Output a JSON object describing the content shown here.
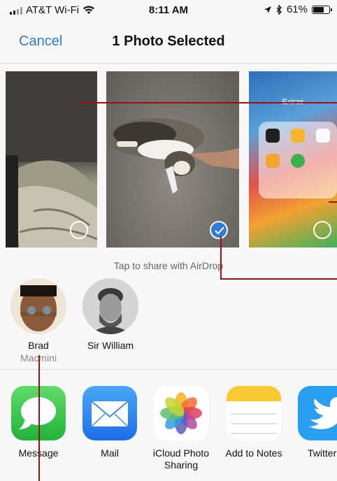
{
  "status_bar": {
    "carrier": "AT&T Wi-Fi",
    "time": "8:11 AM",
    "battery": "61%",
    "battery_level": 0.61
  },
  "nav": {
    "cancel_label": "Cancel",
    "title": "1 Photo Selected"
  },
  "photos": [
    {
      "name": "photo-1",
      "selected": false
    },
    {
      "name": "photo-2",
      "selected": true
    },
    {
      "name": "photo-3",
      "selected": false
    }
  ],
  "photo3_overlay": {
    "folder_label": "Extras"
  },
  "airdrop": {
    "hint": "Tap to share with AirDrop",
    "contacts": [
      {
        "name": "Brad",
        "device": "Macmini"
      },
      {
        "name": "Sir William",
        "device": ""
      }
    ]
  },
  "apps": [
    {
      "label": "Message",
      "icon": "messages-icon",
      "color": "#39c24d"
    },
    {
      "label": "Mail",
      "icon": "mail-icon",
      "color": "#2f8cf0"
    },
    {
      "label": "iCloud Photo Sharing",
      "icon": "photos-icon",
      "color": "#ffffff"
    },
    {
      "label": "Add to Notes",
      "icon": "notes-icon",
      "color": "#ffffff"
    },
    {
      "label": "Twitter",
      "icon": "twitter-icon",
      "color": "#2a9ff2"
    }
  ],
  "colors": {
    "accent": "#2f7bd8",
    "annotation": "#a01010"
  }
}
